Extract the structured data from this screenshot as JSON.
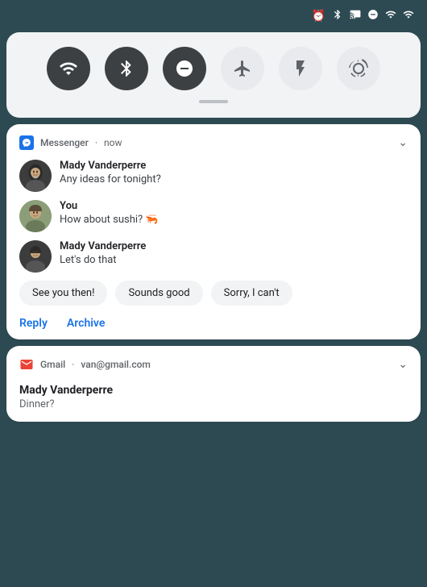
{
  "statusBar": {
    "icons": [
      "alarm",
      "bluetooth",
      "cast",
      "dnd",
      "wifi",
      "signal"
    ]
  },
  "quickSettings": {
    "buttons": [
      {
        "name": "wifi",
        "label": "Wi-Fi",
        "active": true,
        "icon": "wifi"
      },
      {
        "name": "bluetooth",
        "label": "Bluetooth",
        "active": true,
        "icon": "bluetooth"
      },
      {
        "name": "dnd",
        "label": "Do Not Disturb",
        "active": true,
        "icon": "dnd"
      },
      {
        "name": "airplane",
        "label": "Airplane mode",
        "active": false,
        "icon": "airplane"
      },
      {
        "name": "flashlight",
        "label": "Flashlight",
        "active": false,
        "icon": "flashlight"
      },
      {
        "name": "rotate",
        "label": "Auto-rotate",
        "active": false,
        "icon": "rotate"
      }
    ]
  },
  "messengerNotif": {
    "appName": "Messenger",
    "time": "now",
    "messages": [
      {
        "sender": "Mady Vanderperre",
        "text": "Any ideas for tonight?",
        "isSelf": false
      },
      {
        "sender": "You",
        "text": "How about sushi? 🦐",
        "isSelf": true
      },
      {
        "sender": "Mady Vanderperre",
        "text": "Let's do that",
        "isSelf": false
      }
    ],
    "quickReplies": [
      {
        "label": "See you then!"
      },
      {
        "label": "Sounds good"
      },
      {
        "label": "Sorry, I can't"
      }
    ],
    "actions": [
      {
        "label": "Reply"
      },
      {
        "label": "Archive"
      }
    ]
  },
  "gmailNotif": {
    "appName": "Gmail",
    "account": "van@gmail.com",
    "sender": "Mady Vanderperre",
    "subject": "Dinner?"
  }
}
